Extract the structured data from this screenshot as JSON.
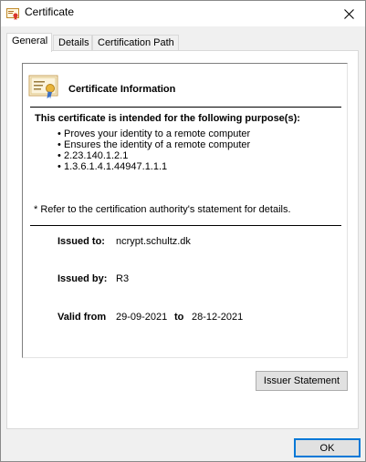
{
  "window": {
    "title": "Certificate"
  },
  "tabs": [
    {
      "label": "General",
      "active": true
    },
    {
      "label": "Details",
      "active": false
    },
    {
      "label": "Certification Path",
      "active": false
    }
  ],
  "certificate": {
    "heading": "Certificate Information",
    "purpose_heading": "This certificate is intended for the following purpose(s):",
    "purposes": [
      "Proves your identity to a remote computer",
      "Ensures the identity of a remote computer",
      "2.23.140.1.2.1",
      "1.3.6.1.4.1.44947.1.1.1"
    ],
    "footnote": "* Refer to the certification authority's statement for details.",
    "issued_to_label": "Issued to:",
    "issued_to": "ncrypt.schultz.dk",
    "issued_by_label": "Issued by:",
    "issued_by": "R3",
    "valid_from_label": "Valid from",
    "valid_from": "29-09-2021",
    "valid_to_label": "to",
    "valid_to": "28-12-2021"
  },
  "buttons": {
    "issuer_statement": "Issuer Statement",
    "ok": "OK"
  },
  "colors": {
    "accent": "#0078d7",
    "button_face": "#e1e1e1",
    "panel_bg": "#f0f0f0"
  },
  "icons": {
    "window": "certificate-icon",
    "close": "close-icon",
    "info": "certificate-ribbon-icon"
  }
}
